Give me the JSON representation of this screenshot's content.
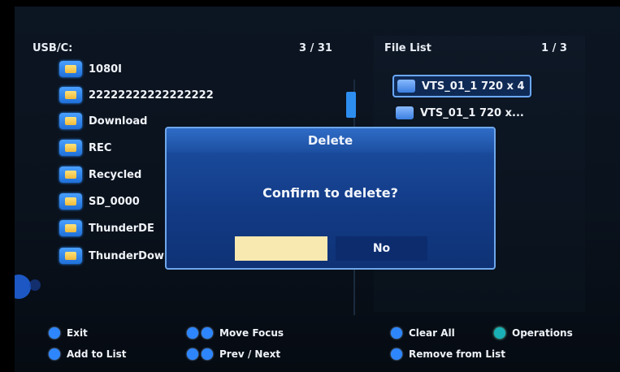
{
  "left_panel": {
    "path": "USB/C:",
    "count": "3 / 31",
    "items": [
      {
        "label": "1080I"
      },
      {
        "label": "22222222222222222"
      },
      {
        "label": "Download"
      },
      {
        "label": "REC"
      },
      {
        "label": "Recycled"
      },
      {
        "label": "SD_0000"
      },
      {
        "label": "ThunderDE"
      },
      {
        "label": "ThunderDownLoad"
      }
    ]
  },
  "right_panel": {
    "title": "File List",
    "count": "1 / 3",
    "items": [
      {
        "label": "VTS_01_1 720 x 4",
        "selected": true
      },
      {
        "label": "VTS_01_1 720 x...",
        "selected": false
      }
    ]
  },
  "dialog": {
    "title": "Delete",
    "message": "Confirm to delete?",
    "no_label": "No"
  },
  "hints": {
    "exit": "Exit",
    "add_to_list": "Add to List",
    "move_focus": "Move Focus",
    "prev_next": "Prev / Next",
    "clear_all": "Clear All",
    "operations": "Operations",
    "remove_from_list": "Remove from List"
  },
  "colors": {
    "accent": "#2e86ff",
    "dialog_bg": "#123a85",
    "highlight_button": "#f7e9b0"
  }
}
